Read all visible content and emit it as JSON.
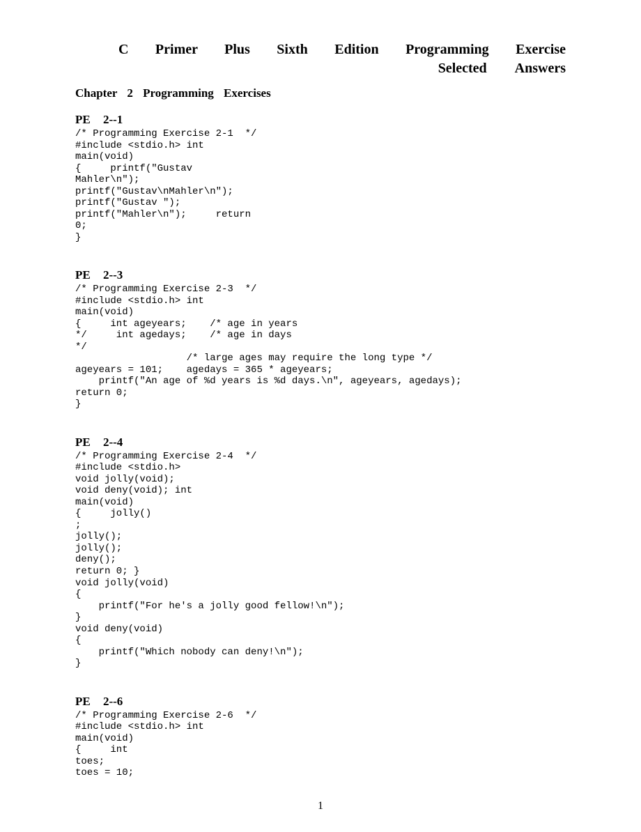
{
  "title_line1": "C Primer Plus Sixth Edition Programming Exercise",
  "title_line2": "Selected  Answers",
  "chapter_heading": "Chapter 2 Programming Exercises",
  "page_number": "1",
  "sections": {
    "pe_2_1": {
      "heading": "PE 2-­‐1",
      "code": "/* Programming Exercise 2-1  */\n#include <stdio.h> int\nmain(void)\n{     printf(\"Gustav\nMahler\\n\");\nprintf(\"Gustav\\nMahler\\n\");\nprintf(\"Gustav \");\nprintf(\"Mahler\\n\");     return\n0;\n}"
    },
    "pe_2_3": {
      "heading": "PE 2-­‐3",
      "code": "/* Programming Exercise 2-3  */\n#include <stdio.h> int\nmain(void)\n{     int ageyears;    /* age in years\n*/     int agedays;    /* age in days\n*/\n                   /* large ages may require the long type */\nageyears = 101;    agedays = 365 * ageyears;\n    printf(\"An age of %d years is %d days.\\n\", ageyears, agedays);\nreturn 0;\n}"
    },
    "pe_2_4": {
      "heading": "PE 2-­‐4",
      "code": "/* Programming Exercise 2-4  */\n#include <stdio.h>\nvoid jolly(void);\nvoid deny(void); int\nmain(void)\n{     jolly()\n;\njolly();\njolly();\ndeny();\nreturn 0; }\nvoid jolly(void)\n{\n    printf(\"For he's a jolly good fellow!\\n\");\n}\nvoid deny(void)\n{\n    printf(\"Which nobody can deny!\\n\");\n}"
    },
    "pe_2_6": {
      "heading": "PE 2-­‐6",
      "code": "/* Programming Exercise 2-6  */\n#include <stdio.h> int\nmain(void)\n{     int\ntoes;\ntoes = 10;"
    }
  }
}
